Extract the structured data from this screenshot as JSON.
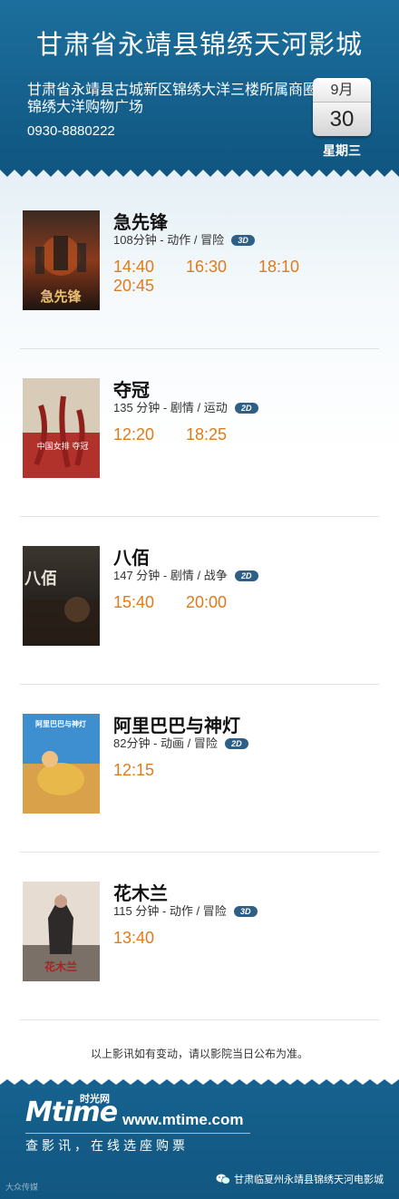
{
  "cinema": {
    "title": "甘肃省永靖县锦绣天河影城",
    "address": "甘肃省永靖县古城新区锦绣大洋三楼所属商圈锦绣大洋购物广场",
    "phone": "0930-8880222"
  },
  "date": {
    "month": "9月",
    "day": "30",
    "weekday": "星期三"
  },
  "movies": [
    {
      "title": "急先锋",
      "info": "108分钟 - 动作 / 冒险",
      "format": "3D",
      "times": [
        "14:40",
        "16:30",
        "18:10",
        "20:45"
      ]
    },
    {
      "title": "夺冠",
      "info": "135 分钟 - 剧情 / 运动",
      "format": "2D",
      "times": [
        "12:20",
        "18:25"
      ]
    },
    {
      "title": "八佰",
      "info": "147 分钟 - 剧情 / 战争",
      "format": "2D",
      "times": [
        "15:40",
        "20:00"
      ]
    },
    {
      "title": "阿里巴巴与神灯",
      "info": "82分钟 - 动画 / 冒险",
      "format": "2D",
      "times": [
        "12:15"
      ]
    },
    {
      "title": "花木兰",
      "info": "115 分钟 - 动作 / 冒险",
      "format": "3D",
      "times": [
        "13:40"
      ]
    }
  ],
  "poster_texts": {
    "p1": "急先锋",
    "p2": "中国女排 夺冠",
    "p3": "八佰",
    "p4": "阿里巴巴与神灯",
    "p5": "花木兰"
  },
  "notice": "以上影讯如有变动，请以影院当日公布为准。",
  "footer": {
    "logo": "Mtime",
    "logo_cn": "时光网",
    "url": "www.mtime.com",
    "slogan": "查影讯，在线选座购票",
    "wechat": "甘肃临夏州永靖县锦绣天河电影城",
    "credit": "大众传媒"
  },
  "colors": {
    "header_blue": "#15608d",
    "showtime_orange": "#e07b1a",
    "format_badge": "#2d5f87"
  }
}
